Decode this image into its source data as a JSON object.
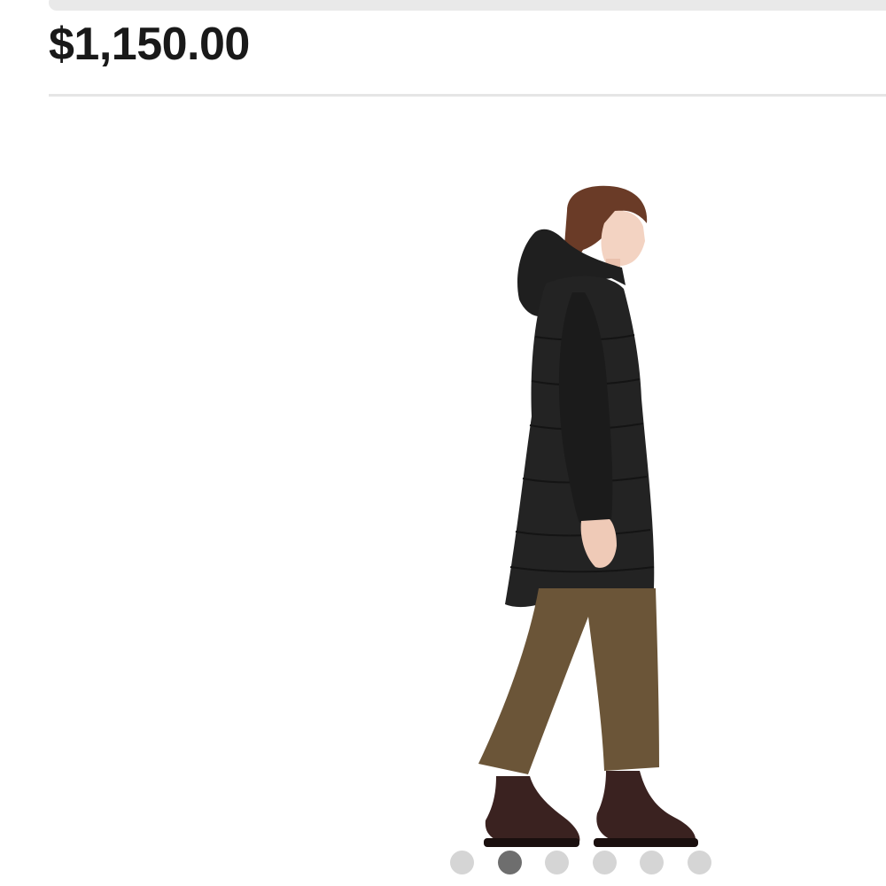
{
  "listing": {
    "price": "$1,150.00"
  },
  "gallery": {
    "image_subject": "model-in-black-long-puffer-coat",
    "image_count": 6,
    "active_index": 1
  },
  "colors": {
    "price_text": "#191919",
    "divider": "#e5e5e5",
    "dot_inactive": "#d5d5d5",
    "dot_active": "#6e6e6e",
    "coat": "#222222",
    "pants": "#6b5538",
    "boots": "#3a2220"
  }
}
